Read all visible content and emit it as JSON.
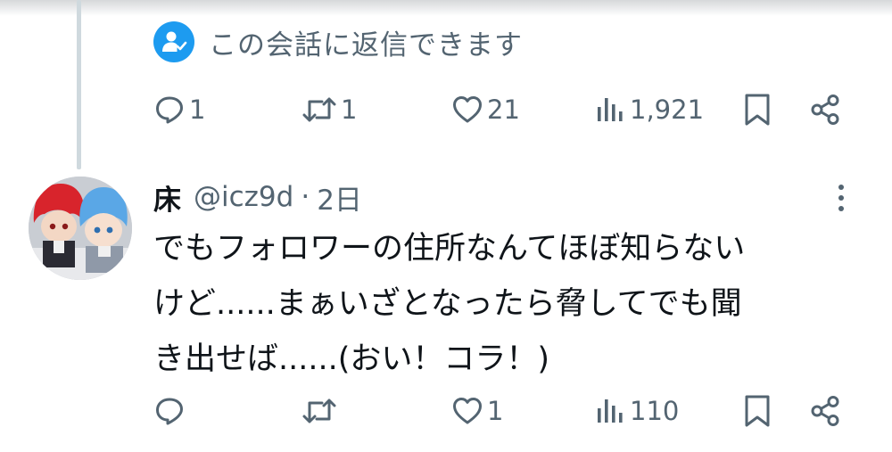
{
  "thread": {
    "reply_notice": "この会話に返信できます",
    "parent_actions": {
      "reply_count": "1",
      "retweet_count": "1",
      "like_count": "21",
      "view_count": "1,921"
    }
  },
  "reply_tweet": {
    "display_name": "床",
    "handle": "@icz9d",
    "separator": "·",
    "time": "2日",
    "text_lines": [
      "でもフォロワーの住所なんてほぼ知らない",
      "けど......まぁいざとなったら脅してでも聞",
      "き出せば......(おい！コラ！)"
    ],
    "actions": {
      "reply_count": "",
      "retweet_count": "",
      "like_count": "1",
      "view_count": "110"
    }
  },
  "icons": [
    "reply-icon",
    "retweet-icon",
    "like-icon",
    "views-icon",
    "bookmark-icon",
    "share-icon",
    "more-icon",
    "reply-permission-icon"
  ],
  "colors": {
    "accent": "#1d9bf0",
    "secondary_text": "#536471",
    "primary_text": "#0f1419"
  }
}
